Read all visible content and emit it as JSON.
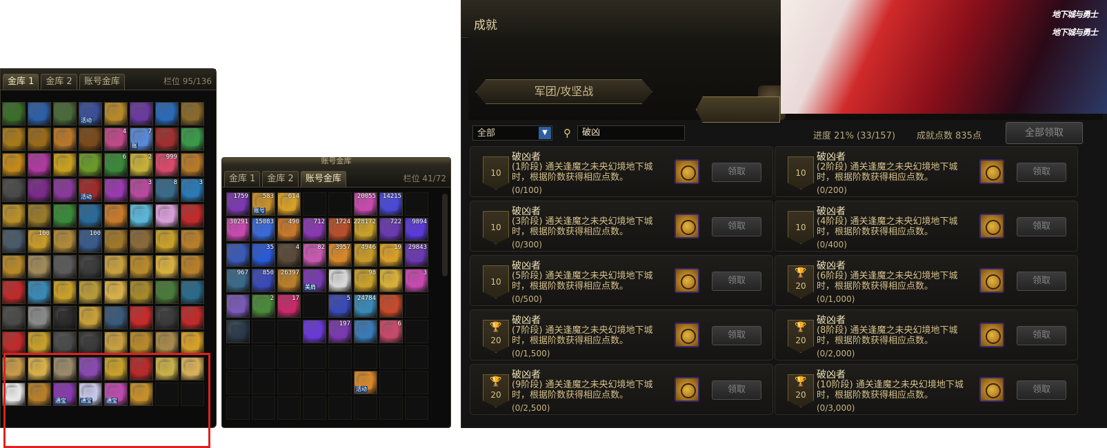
{
  "bank1": {
    "tabs": [
      "金库 1",
      "金库 2",
      "账号金库"
    ],
    "slots_label": "栏位",
    "slots_value": "95/136",
    "rows": [
      [
        {
          "c": "#3b6e2a"
        },
        {
          "c": "#2d5fa8"
        },
        {
          "c": "#4a6a3a"
        },
        {
          "c": "#3a4f9a",
          "tag": "活动"
        },
        {
          "c": "#b88a2a"
        },
        {
          "c": "#6a3aa0"
        },
        {
          "c": "#2a6ab8"
        },
        {
          "c": "#8a6a2a"
        }
      ],
      [
        {
          "c": "#a87a1a"
        },
        {
          "c": "#9a6a1a"
        },
        {
          "c": "#b8782a"
        },
        {
          "c": "#7a4a1a"
        },
        {
          "c": "#c04a8a",
          "q": "4"
        },
        {
          "c": "#5a8ad8",
          "q": "7",
          "tag": "账"
        },
        {
          "c": "#a03030"
        },
        {
          "c": "#3a9a4a"
        }
      ],
      [
        {
          "c": "#c48a1a"
        },
        {
          "c": "#b03aa0"
        },
        {
          "c": "#c8a020"
        },
        {
          "c": "#6a9a2a"
        },
        {
          "c": "#3a8a3a",
          "q": "6"
        },
        {
          "c": "#c8b03a",
          "q": "2"
        },
        {
          "c": "#d84a6a",
          "q": "999"
        },
        {
          "c": "#b87a2a"
        }
      ],
      [
        {
          "c": "#4a4a4a"
        },
        {
          "c": "#7a2a8a"
        },
        {
          "c": "#8a3a9a"
        },
        {
          "c": "#a02a2a",
          "tag": "活动"
        },
        {
          "c": "#9a3ab0"
        },
        {
          "c": "#b84aa0",
          "q": "3"
        },
        {
          "c": "#3a6a8a",
          "q": "8"
        },
        {
          "c": "#2a7ab8",
          "q": "3"
        }
      ],
      [
        {
          "c": "#b8902a"
        },
        {
          "c": "#9a7a2a"
        },
        {
          "c": "#3a8a3a"
        },
        {
          "c": "#2a6a9a"
        },
        {
          "c": "#c87a2a"
        },
        {
          "c": "#5ab8d8"
        },
        {
          "c": "#d8a0d8"
        },
        {
          "c": "#c02a2a"
        }
      ],
      [
        {
          "c": "#4a5a6a"
        },
        {
          "c": "#c89a2a",
          "q": "100"
        },
        {
          "c": "#b08a3a"
        },
        {
          "c": "#3a5a8a",
          "q": "100"
        },
        {
          "c": "#a0782a"
        },
        {
          "c": "#8a6a3a"
        },
        {
          "c": "#c8a02a"
        },
        {
          "c": "#b8802a"
        }
      ],
      [
        {
          "c": "#b8882a"
        },
        {
          "c": "#a08a5a"
        },
        {
          "c": "#5a5a5a"
        },
        {
          "c": "#3a3a3a"
        },
        {
          "c": "#c8a040"
        },
        {
          "c": "#b88a2a"
        },
        {
          "c": "#d8b040"
        },
        {
          "c": "#b8802a"
        }
      ],
      [
        {
          "c": "#c02a2a"
        },
        {
          "c": "#3a8ab8"
        },
        {
          "c": "#c8a02a"
        },
        {
          "c": "#b89a3a"
        },
        {
          "c": "#d8b04a"
        },
        {
          "c": "#a88a2a"
        },
        {
          "c": "#4a7a3a"
        },
        {
          "c": "#2a6a8a"
        }
      ],
      [
        {
          "c": "#4a4a4a"
        },
        {
          "c": "#8a8a8a"
        },
        {
          "c": "#2a2a2a"
        },
        {
          "c": "#c8a03a"
        },
        {
          "c": "#3a5a7a"
        },
        {
          "c": "#c82a2a"
        },
        {
          "c": "#3a3a3a"
        },
        {
          "c": "#c02a2a"
        }
      ],
      [
        {
          "c": "#c02a2a"
        },
        {
          "c": "#c8a02a"
        },
        {
          "c": "#4a4a4a"
        },
        {
          "c": "#3a3a3a"
        },
        {
          "c": "#c8a040"
        },
        {
          "c": "#b88a2a"
        },
        {
          "c": "#a88a4a"
        },
        {
          "c": "#d8a02a"
        }
      ],
      [
        {
          "c": "#c89a4a"
        },
        {
          "c": "#d8b04a"
        },
        {
          "c": "#9a8a6a"
        },
        {
          "c": "#8a4ab0"
        },
        {
          "c": "#c8a02a"
        },
        {
          "c": "#b82a2a"
        },
        {
          "c": "#c8b04a"
        },
        {
          "c": "#d8b05a"
        }
      ],
      [
        {
          "c": "#e8e8e8"
        },
        {
          "c": "#b8802a"
        },
        {
          "c": "#8a3ab0",
          "tag": "通宝"
        },
        {
          "c": "#c8c8e8",
          "tag": "通宝"
        },
        {
          "c": "#c04ab0",
          "tag": "通宝"
        },
        {
          "c": "#c8902a"
        },
        {
          "c": "empty"
        },
        {
          "c": "empty"
        }
      ]
    ]
  },
  "bank2": {
    "title": "账号金库",
    "tabs": [
      "金库 1",
      "金库 2",
      "账号金库"
    ],
    "slots_label": "栏位",
    "slots_value": "41/72",
    "rows": [
      [
        {
          "c": "#7a3ab0",
          "q": "1759"
        },
        {
          "c": "#c8902a",
          "q": "583",
          "tag": "账号"
        },
        {
          "c": "#d8a02a",
          "q": "614"
        },
        {
          "c": "empty"
        },
        {
          "c": "empty"
        },
        {
          "c": "#c84ab0",
          "q": "20055"
        },
        {
          "c": "#4a4ad8",
          "q": "14215"
        },
        {
          "c": "empty"
        }
      ],
      [
        {
          "c": "#c84ab0",
          "q": "30291"
        },
        {
          "c": "#3a6ad8",
          "q": "15083"
        },
        {
          "c": "#c8782a",
          "q": "490"
        },
        {
          "c": "#8a3ab0",
          "q": "712"
        },
        {
          "c": "#b8502a",
          "q": "1724"
        },
        {
          "c": "#c8a02a",
          "q": "228172"
        },
        {
          "c": "#6a3ab0",
          "q": "722"
        },
        {
          "c": "#5a3ad8",
          "q": "9894"
        }
      ],
      [
        {
          "c": "#3a5ab8"
        },
        {
          "c": "#2a5ad8",
          "q": "35"
        },
        {
          "c": "#5a4a3a",
          "q": "4"
        },
        {
          "c": "#c85ab0",
          "q": "82"
        },
        {
          "c": "#d8882a",
          "q": "3957"
        },
        {
          "c": "#c89a2a",
          "q": "4946"
        },
        {
          "c": "#d8a02a",
          "q": "19"
        },
        {
          "c": "#6a3ab0",
          "q": "29843"
        }
      ],
      [
        {
          "c": "#3a6a8a",
          "q": "967"
        },
        {
          "c": "#3a4ab8",
          "q": "850"
        },
        {
          "c": "#b8802a",
          "q": "26397"
        },
        {
          "c": "#7a3ab0",
          "tag": "美肩"
        },
        {
          "c": "#d8d8d8"
        },
        {
          "c": "#c8a02a",
          "q": "98"
        },
        {
          "c": "#d8b03a"
        },
        {
          "c": "#c84ab0",
          "q": "3"
        }
      ],
      [
        {
          "c": "#7a5ab8"
        },
        {
          "c": "#4a8a3a",
          "q": "2"
        },
        {
          "c": "#c82a6a",
          "q": "17"
        },
        {
          "c": "empty"
        },
        {
          "c": "#3a4ab8",
          "q": "5"
        },
        {
          "c": "#3a8ab8",
          "q": "24784"
        },
        {
          "c": "#c84a2a"
        },
        {
          "c": "empty"
        }
      ],
      [
        {
          "c": "#2a3a4a"
        },
        {
          "c": "empty"
        },
        {
          "c": "empty"
        },
        {
          "c": "#6a3ad8"
        },
        {
          "c": "#7a3ab0",
          "q": "197"
        },
        {
          "c": "#3a7ab8"
        },
        {
          "c": "#c84a6a",
          "q": "6"
        },
        {
          "c": "empty"
        }
      ],
      [
        {
          "c": "empty"
        },
        {
          "c": "empty"
        },
        {
          "c": "empty"
        },
        {
          "c": "empty"
        },
        {
          "c": "empty"
        },
        {
          "c": "empty"
        },
        {
          "c": "empty"
        },
        {
          "c": "empty"
        }
      ],
      [
        {
          "c": "empty"
        },
        {
          "c": "empty"
        },
        {
          "c": "empty"
        },
        {
          "c": "empty"
        },
        {
          "c": "empty"
        },
        {
          "c": "#d8882a",
          "tag": "活动"
        },
        {
          "c": "empty"
        },
        {
          "c": "empty"
        }
      ],
      [
        {
          "c": "empty"
        },
        {
          "c": "empty"
        },
        {
          "c": "empty"
        },
        {
          "c": "empty"
        },
        {
          "c": "empty"
        },
        {
          "c": "empty"
        },
        {
          "c": "empty"
        },
        {
          "c": "empty"
        }
      ]
    ]
  },
  "achv": {
    "title": "成就",
    "category_tab": "军团/攻坚战",
    "filter_value": "全部",
    "search_value": "破凶",
    "progress": "进度  21% (33/157)",
    "points": "成就点数 835点",
    "claim_all": "全部领取",
    "logo1": "地下城与勇士",
    "logo2": "地下城与勇士",
    "cards": [
      {
        "name": "破凶者",
        "desc": "(1阶段) 通关逢魔之未央幻境地下城时，根据阶数获得相应点数。",
        "frac": "(0/100)",
        "badge": "10",
        "trophy": false,
        "claim": "领取"
      },
      {
        "name": "破凶者",
        "desc": "(2阶段) 通关逢魔之未央幻境地下城时，根据阶数获得相应点数。",
        "frac": "(0/200)",
        "badge": "10",
        "trophy": false,
        "claim": "领取"
      },
      {
        "name": "破凶者",
        "desc": "(3阶段) 通关逢魔之未央幻境地下城时，根据阶数获得相应点数。",
        "frac": "(0/300)",
        "badge": "10",
        "trophy": false,
        "claim": "领取"
      },
      {
        "name": "破凶者",
        "desc": "(4阶段) 通关逢魔之未央幻境地下城时，根据阶数获得相应点数。",
        "frac": "(0/400)",
        "badge": "10",
        "trophy": false,
        "claim": "领取"
      },
      {
        "name": "破凶者",
        "desc": "(5阶段) 通关逢魔之未央幻境地下城时，根据阶数获得相应点数。",
        "frac": "(0/500)",
        "badge": "10",
        "trophy": false,
        "claim": "领取"
      },
      {
        "name": "破凶者",
        "desc": "(6阶段) 通关逢魔之未央幻境地下城时，根据阶数获得相应点数。",
        "frac": "(0/1,000)",
        "badge": "20",
        "trophy": true,
        "claim": "领取"
      },
      {
        "name": "破凶者",
        "desc": "(7阶段) 通关逢魔之未央幻境地下城时，根据阶数获得相应点数。",
        "frac": "(0/1,500)",
        "badge": "20",
        "trophy": true,
        "claim": "领取"
      },
      {
        "name": "破凶者",
        "desc": "(8阶段) 通关逢魔之未央幻境地下城时，根据阶数获得相应点数。",
        "frac": "(0/2,000)",
        "badge": "20",
        "trophy": true,
        "claim": "领取"
      },
      {
        "name": "破凶者",
        "desc": "(9阶段) 通关逢魔之未央幻境地下城时，根据阶数获得相应点数。",
        "frac": "(0/2,500)",
        "badge": "20",
        "trophy": true,
        "claim": "领取"
      },
      {
        "name": "破凶者",
        "desc": "(10阶段) 通关逢魔之未央幻境地下城时，根据阶数获得相应点数。",
        "frac": "(0/3,000)",
        "badge": "20",
        "trophy": true,
        "claim": "领取"
      }
    ]
  }
}
